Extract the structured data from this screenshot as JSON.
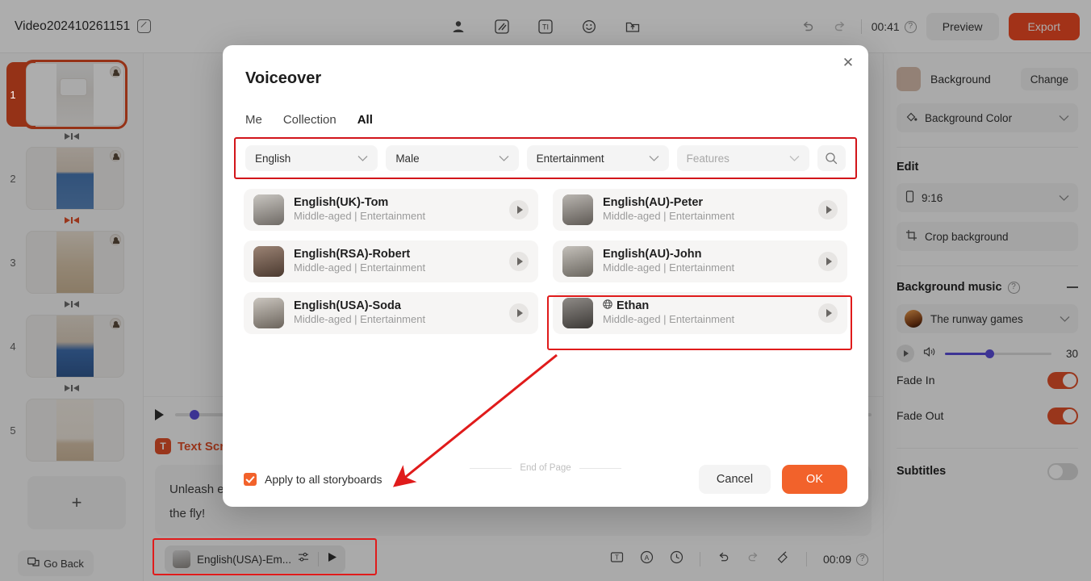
{
  "app": {
    "project_title": "Video202410261151",
    "edit_icon": "pencil-icon",
    "toolbar_icons": [
      "avatar-icon",
      "transition-icon",
      "text-icon",
      "sticker-icon",
      "upload-icon"
    ],
    "undo_icon": "undo-icon",
    "redo_icon": "redo-icon",
    "duration": "00:41",
    "help_icon": "help-icon",
    "preview_label": "Preview",
    "export_label": "Export",
    "accent_color": "#ef4a24",
    "ok_color": "#f2622b"
  },
  "storyboard": {
    "items": [
      {
        "number": "1",
        "selected": true
      },
      {
        "number": "2",
        "selected": false
      },
      {
        "number": "3",
        "selected": false
      },
      {
        "number": "4",
        "selected": false
      },
      {
        "number": "5",
        "selected": false
      }
    ],
    "add_label": "+",
    "go_back_label": "Go Back",
    "go_back_icon": "back-frames-icon"
  },
  "stage": {
    "play_icon": "play-icon",
    "script_header": "Text Script",
    "script_badge": "T",
    "script_text": "Unleash e                the fly!",
    "script_line1": "Unleash e",
    "script_line2": "the fly!",
    "voice_chip": {
      "name": "English(USA)-Em...",
      "settings_icon": "sliders-icon",
      "play_icon": "play-icon"
    },
    "bottom_tools": [
      "text-box-icon",
      "animation-icon",
      "duration-clock-icon",
      "undo-icon",
      "redo-icon",
      "format-brush-icon"
    ],
    "bottom_duration": "00:09",
    "bottom_help_icon": "help-icon"
  },
  "right_panel": {
    "background_label": "Background",
    "change_label": "Change",
    "background_color_label": "Background Color",
    "background_color_icon": "paint-bucket-icon",
    "edit_title": "Edit",
    "ratio_label": "9:16",
    "ratio_icon": "phone-icon",
    "crop_label": "Crop background",
    "crop_icon": "crop-icon",
    "music_title": "Background music",
    "music_help_icon": "help-icon",
    "music_collapse_icon": "minus-icon",
    "music_track": "The runway games",
    "music_volume": "30",
    "volume_icon": "speaker-icon",
    "fade_in_label": "Fade In",
    "fade_in_on": true,
    "fade_out_label": "Fade Out",
    "fade_out_on": true,
    "subtitles_label": "Subtitles",
    "subtitles_on": false
  },
  "modal": {
    "title": "Voiceover",
    "close_icon": "close-icon",
    "tabs": [
      {
        "label": "Me",
        "active": false
      },
      {
        "label": "Collection",
        "active": false
      },
      {
        "label": "All",
        "active": true
      }
    ],
    "filters": [
      {
        "name": "language-filter",
        "value": "English",
        "placeholder": false
      },
      {
        "name": "gender-filter",
        "value": "Male",
        "placeholder": false
      },
      {
        "name": "style-filter",
        "value": "Entertainment",
        "placeholder": false
      },
      {
        "name": "features-filter",
        "value": "Features",
        "placeholder": true
      }
    ],
    "search_icon": "search-icon",
    "voices": [
      {
        "name": "English(UK)-Tom",
        "meta": "Middle-aged | Entertainment",
        "globe": false,
        "highlighted": false
      },
      {
        "name": "English(AU)-Peter",
        "meta": "Middle-aged | Entertainment",
        "globe": false,
        "highlighted": false
      },
      {
        "name": "English(RSA)-Robert",
        "meta": "Middle-aged | Entertainment",
        "globe": false,
        "highlighted": false
      },
      {
        "name": "English(AU)-John",
        "meta": "Middle-aged | Entertainment",
        "globe": false,
        "highlighted": false
      },
      {
        "name": "English(USA)-Soda",
        "meta": "Middle-aged | Entertainment",
        "globe": false,
        "highlighted": false
      },
      {
        "name": "Ethan",
        "meta": "Middle-aged | Entertainment",
        "globe": true,
        "highlighted": true
      }
    ],
    "end_of_page": "End of Page",
    "apply_all_label": "Apply to all storyboards",
    "apply_all_checked": true,
    "cancel_label": "Cancel",
    "ok_label": "OK"
  },
  "annotations": {
    "highlight_color": "#d2151a",
    "boxes": [
      "filter-row-highlight",
      "ethan-voice-highlight",
      "voice-chip-highlight"
    ],
    "arrow": "arrow-from-ethan-to-apply-all"
  }
}
